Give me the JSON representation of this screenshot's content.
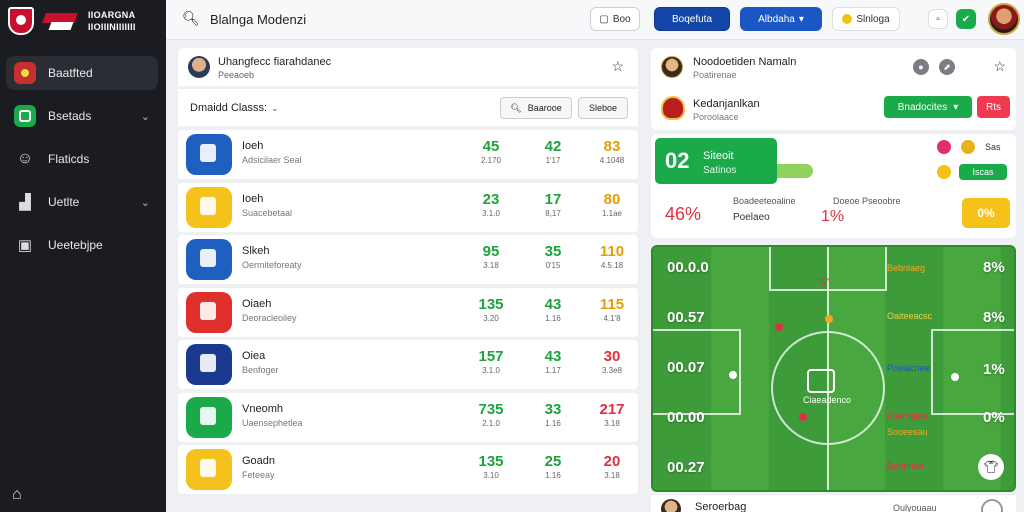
{
  "brand": {
    "line1": "IIOARGNA",
    "line2": "IIOIIINIIIIIII"
  },
  "sidebar": {
    "items": [
      {
        "label": "Baatfted",
        "icon": "football-icon",
        "active": true,
        "chevron": false
      },
      {
        "label": "Bsetads",
        "icon": "pitch-icon",
        "active": false,
        "chevron": true
      },
      {
        "label": "Flaticds",
        "icon": "people-icon",
        "active": false,
        "chevron": false
      },
      {
        "label": "Uetlte",
        "icon": "chart-icon",
        "active": false,
        "chevron": true
      },
      {
        "label": "Ueetebjpe",
        "icon": "box-icon",
        "active": false,
        "chevron": false
      }
    ],
    "bottom_icon": "home-icon"
  },
  "topbar": {
    "title": "Blalnga Modenzi",
    "btn1": "Boo",
    "btn2": "Boqefuta",
    "btn3": "Albdaha",
    "btn4": "Slnloga"
  },
  "list": {
    "header_title": "Uhangfecc fiarahdanec",
    "header_sub": "Peeaoeb",
    "filter_label": "Dmaidd Classs:",
    "search_btn": "Baarooe",
    "filter_btn": "Sleboe",
    "rows": [
      {
        "name": "Ioeh",
        "sub": "Adsicilaer Seal",
        "logo": "#1e5fbf",
        "v1": "45",
        "s1": "2.170",
        "v2": "42",
        "s2": "1'17",
        "v3": "83",
        "s3": "4.1048",
        "c3": "orange"
      },
      {
        "name": "Ioeh",
        "sub": "Suacebetaal",
        "logo": "#f4c21a",
        "v1": "23",
        "s1": "3.1.0",
        "v2": "17",
        "s2": "8,17",
        "v3": "80",
        "s3": "1.1ae",
        "c3": "orange"
      },
      {
        "name": "Slkeh",
        "sub": "Oermiteforeaty",
        "logo": "#1e5fbf",
        "v1": "95",
        "s1": "3.18",
        "v2": "35",
        "s2": "0'15",
        "v3": "110",
        "s3": "4.5.18",
        "c3": "orange"
      },
      {
        "name": "Oiaeh",
        "sub": "Deoracleoiley",
        "logo": "#e0302e",
        "v1": "135",
        "s1": "3.20",
        "v2": "43",
        "s2": "1.16",
        "v3": "115",
        "s3": "4.1'8",
        "c3": "orange"
      },
      {
        "name": "Oiea",
        "sub": "Benfoger",
        "logo": "#1a3a8f",
        "v1": "157",
        "s1": "3.1.0",
        "v2": "43",
        "s2": "1.17",
        "v3": "30",
        "s3": "3.3e8",
        "c3": "red"
      },
      {
        "name": "Vneomh",
        "sub": "Uaensephetlea",
        "logo": "#1aaa4a",
        "v1": "735",
        "s1": "2.1.0",
        "v2": "33",
        "s2": "1.16",
        "v3": "217",
        "s3": "3.18",
        "c3": "red"
      },
      {
        "name": "Goadn",
        "sub": "Feteeay",
        "logo": "#f4c21a",
        "v1": "135",
        "s1": "3.10",
        "v2": "25",
        "s2": "1.16",
        "v3": "20",
        "s3": "3.18",
        "c3": "red"
      }
    ]
  },
  "fixture": {
    "title": "Noodoetiden Namaln",
    "sub": "Poatirenae",
    "team2": "Kedanjanlkan",
    "team2_sub": "Poroolaace",
    "green_btn": "Bnadocites",
    "red_btn": "Rts"
  },
  "scorecard": {
    "score": "02",
    "t1": "Siteoit",
    "t2": "Satinos",
    "pill_label": "Sas",
    "green_small": "Iscas",
    "pct": "46%",
    "info1": "Boadeeteoaline",
    "info2": "Poelaeo",
    "mid": "1%",
    "info3": "Doeoe Pseoobre",
    "yellow": "0%"
  },
  "pitch": {
    "stats": [
      {
        "v": "00.0.0",
        "lbl": ""
      },
      {
        "v": "00.57",
        "lbl": ""
      },
      {
        "v": "00.07",
        "lbl": ""
      },
      {
        "v": "00.00",
        "lbl": ""
      },
      {
        "v": "00.27",
        "lbl": ""
      }
    ],
    "top_value": "\"S\"",
    "right_stats": [
      "8%",
      "8%",
      "1%",
      "0%"
    ],
    "right_labels": [
      "Bebnlaeg",
      "Oaiteeacsc",
      "Poelacnee",
      "Foernaloe",
      "Sooeesau",
      "Dannned"
    ],
    "center_label": "Ciaeadenco"
  },
  "bottom": {
    "title": "Seroerbag",
    "sub": "Oulyouaau"
  },
  "colors": {
    "accent": "#1aaa4a",
    "blue": "#1446a8",
    "red": "#e03040",
    "yellow": "#f6c21a"
  }
}
